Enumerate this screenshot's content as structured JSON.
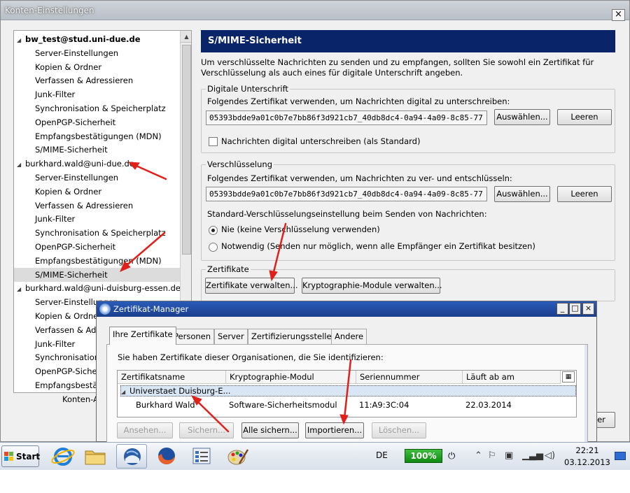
{
  "main_window": {
    "title": "Konten-Einstellungen",
    "close_label": "×"
  },
  "account_tree": {
    "rows": [
      {
        "label": "bw_test@stud.uni-due.de",
        "type": "account",
        "bold": true
      },
      {
        "label": "Server-Einstellungen",
        "type": "sub"
      },
      {
        "label": "Kopien & Ordner",
        "type": "sub"
      },
      {
        "label": "Verfassen & Adressieren",
        "type": "sub"
      },
      {
        "label": "Junk-Filter",
        "type": "sub"
      },
      {
        "label": "Synchronisation & Speicherplatz",
        "type": "sub"
      },
      {
        "label": "OpenPGP-Sicherheit",
        "type": "sub"
      },
      {
        "label": "Empfangsbestätigungen (MDN)",
        "type": "sub"
      },
      {
        "label": "S/MIME-Sicherheit",
        "type": "sub"
      },
      {
        "label": "burkhard.wald@uni-due.de",
        "type": "account"
      },
      {
        "label": "Server-Einstellungen",
        "type": "sub"
      },
      {
        "label": "Kopien & Ordner",
        "type": "sub"
      },
      {
        "label": "Verfassen & Adressieren",
        "type": "sub"
      },
      {
        "label": "Junk-Filter",
        "type": "sub"
      },
      {
        "label": "Synchronisation & Speicherplatz",
        "type": "sub"
      },
      {
        "label": "OpenPGP-Sicherheit",
        "type": "sub"
      },
      {
        "label": "Empfangsbestätigungen (MDN)",
        "type": "sub"
      },
      {
        "label": "S/MIME-Sicherheit",
        "type": "sub",
        "selected": true
      },
      {
        "label": "burkhard.wald@uni-duisburg-essen.de",
        "type": "account"
      },
      {
        "label": "Server-Einstellungen",
        "type": "sub"
      },
      {
        "label": "Kopien & Ordner",
        "type": "sub"
      },
      {
        "label": "Verfassen & Adressieren",
        "type": "sub"
      },
      {
        "label": "Junk-Filter",
        "type": "sub"
      },
      {
        "label": "Synchronisation & Speicherplatz",
        "type": "sub"
      },
      {
        "label": "OpenPGP-Sicherheit",
        "type": "sub"
      },
      {
        "label": "Empfangsbestätigungen (MDN)",
        "type": "sub"
      }
    ],
    "actions_label": "Konten-Aktionen"
  },
  "panel": {
    "title": "S/MIME-Sicherheit",
    "intro": "Um verschlüsselte Nachrichten zu senden und zu empfangen, sollten Sie sowohl ein Zertifikat für Verschlüsselung als auch eines für digitale Unterschrift angeben.",
    "signing": {
      "group_label": "Digitale Unterschrift",
      "desc": "Folgendes Zertifikat verwenden, um Nachrichten digital zu unterschreiben:",
      "cert_value": "05393bdde9a01c0b7e7bb86f3d921cb7_40db8dc4-0a94-4a09-8c85-77",
      "select_label": "Auswählen...",
      "clear_label": "Leeren",
      "checkbox_label": "Nachrichten digital unterschreiben (als Standard)"
    },
    "encryption": {
      "group_label": "Verschlüsselung",
      "desc": "Folgendes Zertifikat verwenden, um Nachrichten zu ver- und entschlüsseln:",
      "cert_value": "05393bdde9a01c0b7e7bb86f3d921cb7_40db8dc4-0a94-4a09-8c85-77",
      "select_label": "Auswählen...",
      "clear_label": "Leeren",
      "default_label": "Standard-Verschlüsselungseinstellung beim Senden von Nachrichten:",
      "radio_never": "Nie (keine Verschlüsselung verwenden)",
      "radio_required": "Notwendig (Senden nur möglich, wenn alle Empfänger ein Zertifikat besitzen)"
    },
    "certificates": {
      "group_label": "Zertifikate",
      "manage_label": "Zertifikate verwalten...",
      "modules_label": "Kryptographie-Module verwalten..."
    },
    "hidden_button_label": "er"
  },
  "cert_manager": {
    "title": "Zertifikat-Manager",
    "minimize": "_",
    "maximize": "□",
    "close": "×",
    "tabs": [
      "Ihre Zertifikate",
      "Personen",
      "Server",
      "Zertifizierungsstellen",
      "Andere"
    ],
    "description": "Sie haben Zertifikate dieser Organisationen, die Sie identifizieren:",
    "columns": [
      "Zertifikatsname",
      "Kryptographie-Modul",
      "Seriennummer",
      "Läuft ab am"
    ],
    "group_name": "Universtaet Duisburg-E...",
    "rows": [
      {
        "name": "Burkhard Wald",
        "module": "Software-Sicherheitsmodul",
        "serial": "11:A9:3C:04",
        "expires": "22.03.2014"
      }
    ],
    "buttons": {
      "view": "Ansehen...",
      "backup": "Sichern...",
      "backup_all": "Alle sichern...",
      "import": "Importieren...",
      "delete": "Löschen..."
    }
  },
  "taskbar": {
    "start_label": "Start",
    "apps": [
      "internet-explorer-icon",
      "folder-icon",
      "thunderbird-icon",
      "firefox-icon",
      "control-panel-icon",
      "paint-icon"
    ],
    "language": "DE",
    "battery_label": "100%",
    "clock_time": "22:21",
    "clock_date": "03.12.2013"
  },
  "colors": {
    "panel_header": "#0a246a",
    "dialog_title": "#1a3e8c",
    "annotation_red": "#e0201a",
    "battery_green": "#2aa52a"
  }
}
